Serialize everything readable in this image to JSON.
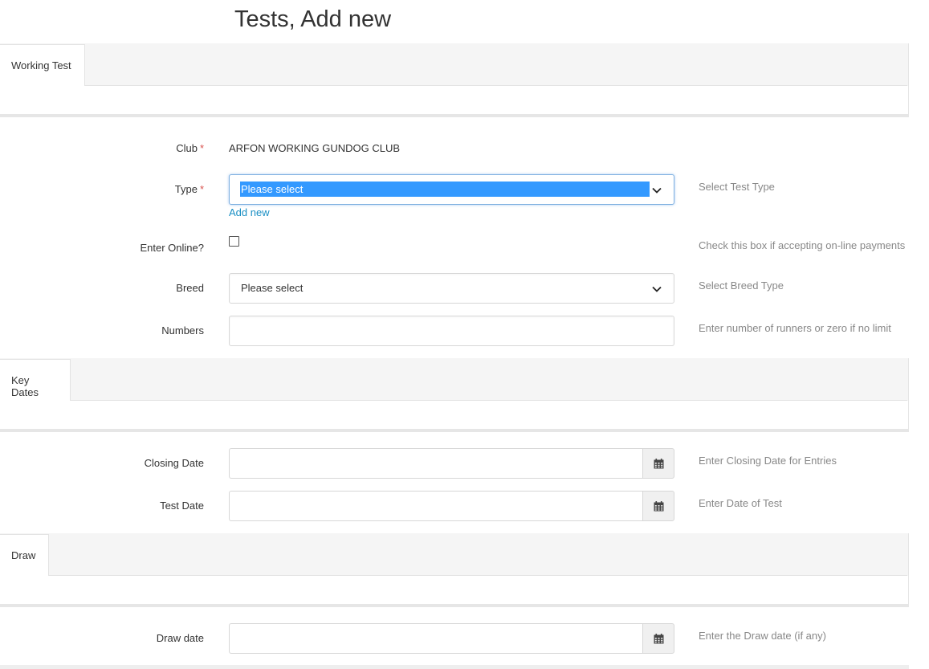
{
  "page": {
    "title": "Tests, Add new"
  },
  "sections": {
    "working_test": {
      "tab_label": "Working Test"
    },
    "key_dates": {
      "tab_label": "Key Dates"
    },
    "draw": {
      "tab_label": "Draw"
    }
  },
  "fields": {
    "club": {
      "label": "Club",
      "required_mark": "*",
      "value": "ARFON WORKING GUNDOG CLUB"
    },
    "type": {
      "label": "Type",
      "required_mark": "*",
      "selected": "Please select",
      "help": "Select Test Type",
      "add_new_label": "Add new"
    },
    "enter_online": {
      "label": "Enter Online?",
      "checked": false,
      "help": "Check this box if accepting on-line payments"
    },
    "breed": {
      "label": "Breed",
      "selected": "Please select",
      "help": "Select Breed Type"
    },
    "numbers": {
      "label": "Numbers",
      "value": "",
      "help": "Enter number of runners or zero if no limit"
    },
    "closing_date": {
      "label": "Closing Date",
      "value": "",
      "help": "Enter Closing Date for Entries",
      "icon": "calendar-icon"
    },
    "test_date": {
      "label": "Test Date",
      "value": "",
      "help": "Enter Date of Test",
      "icon": "calendar-icon"
    },
    "draw_date": {
      "label": "Draw date",
      "value": "",
      "help": "Enter the Draw date (if any)",
      "icon": "calendar-icon"
    }
  },
  "colors": {
    "selection_highlight": "#3399ff",
    "link": "#1a8fc4",
    "required": "#d9534f",
    "help_text": "#888888"
  }
}
